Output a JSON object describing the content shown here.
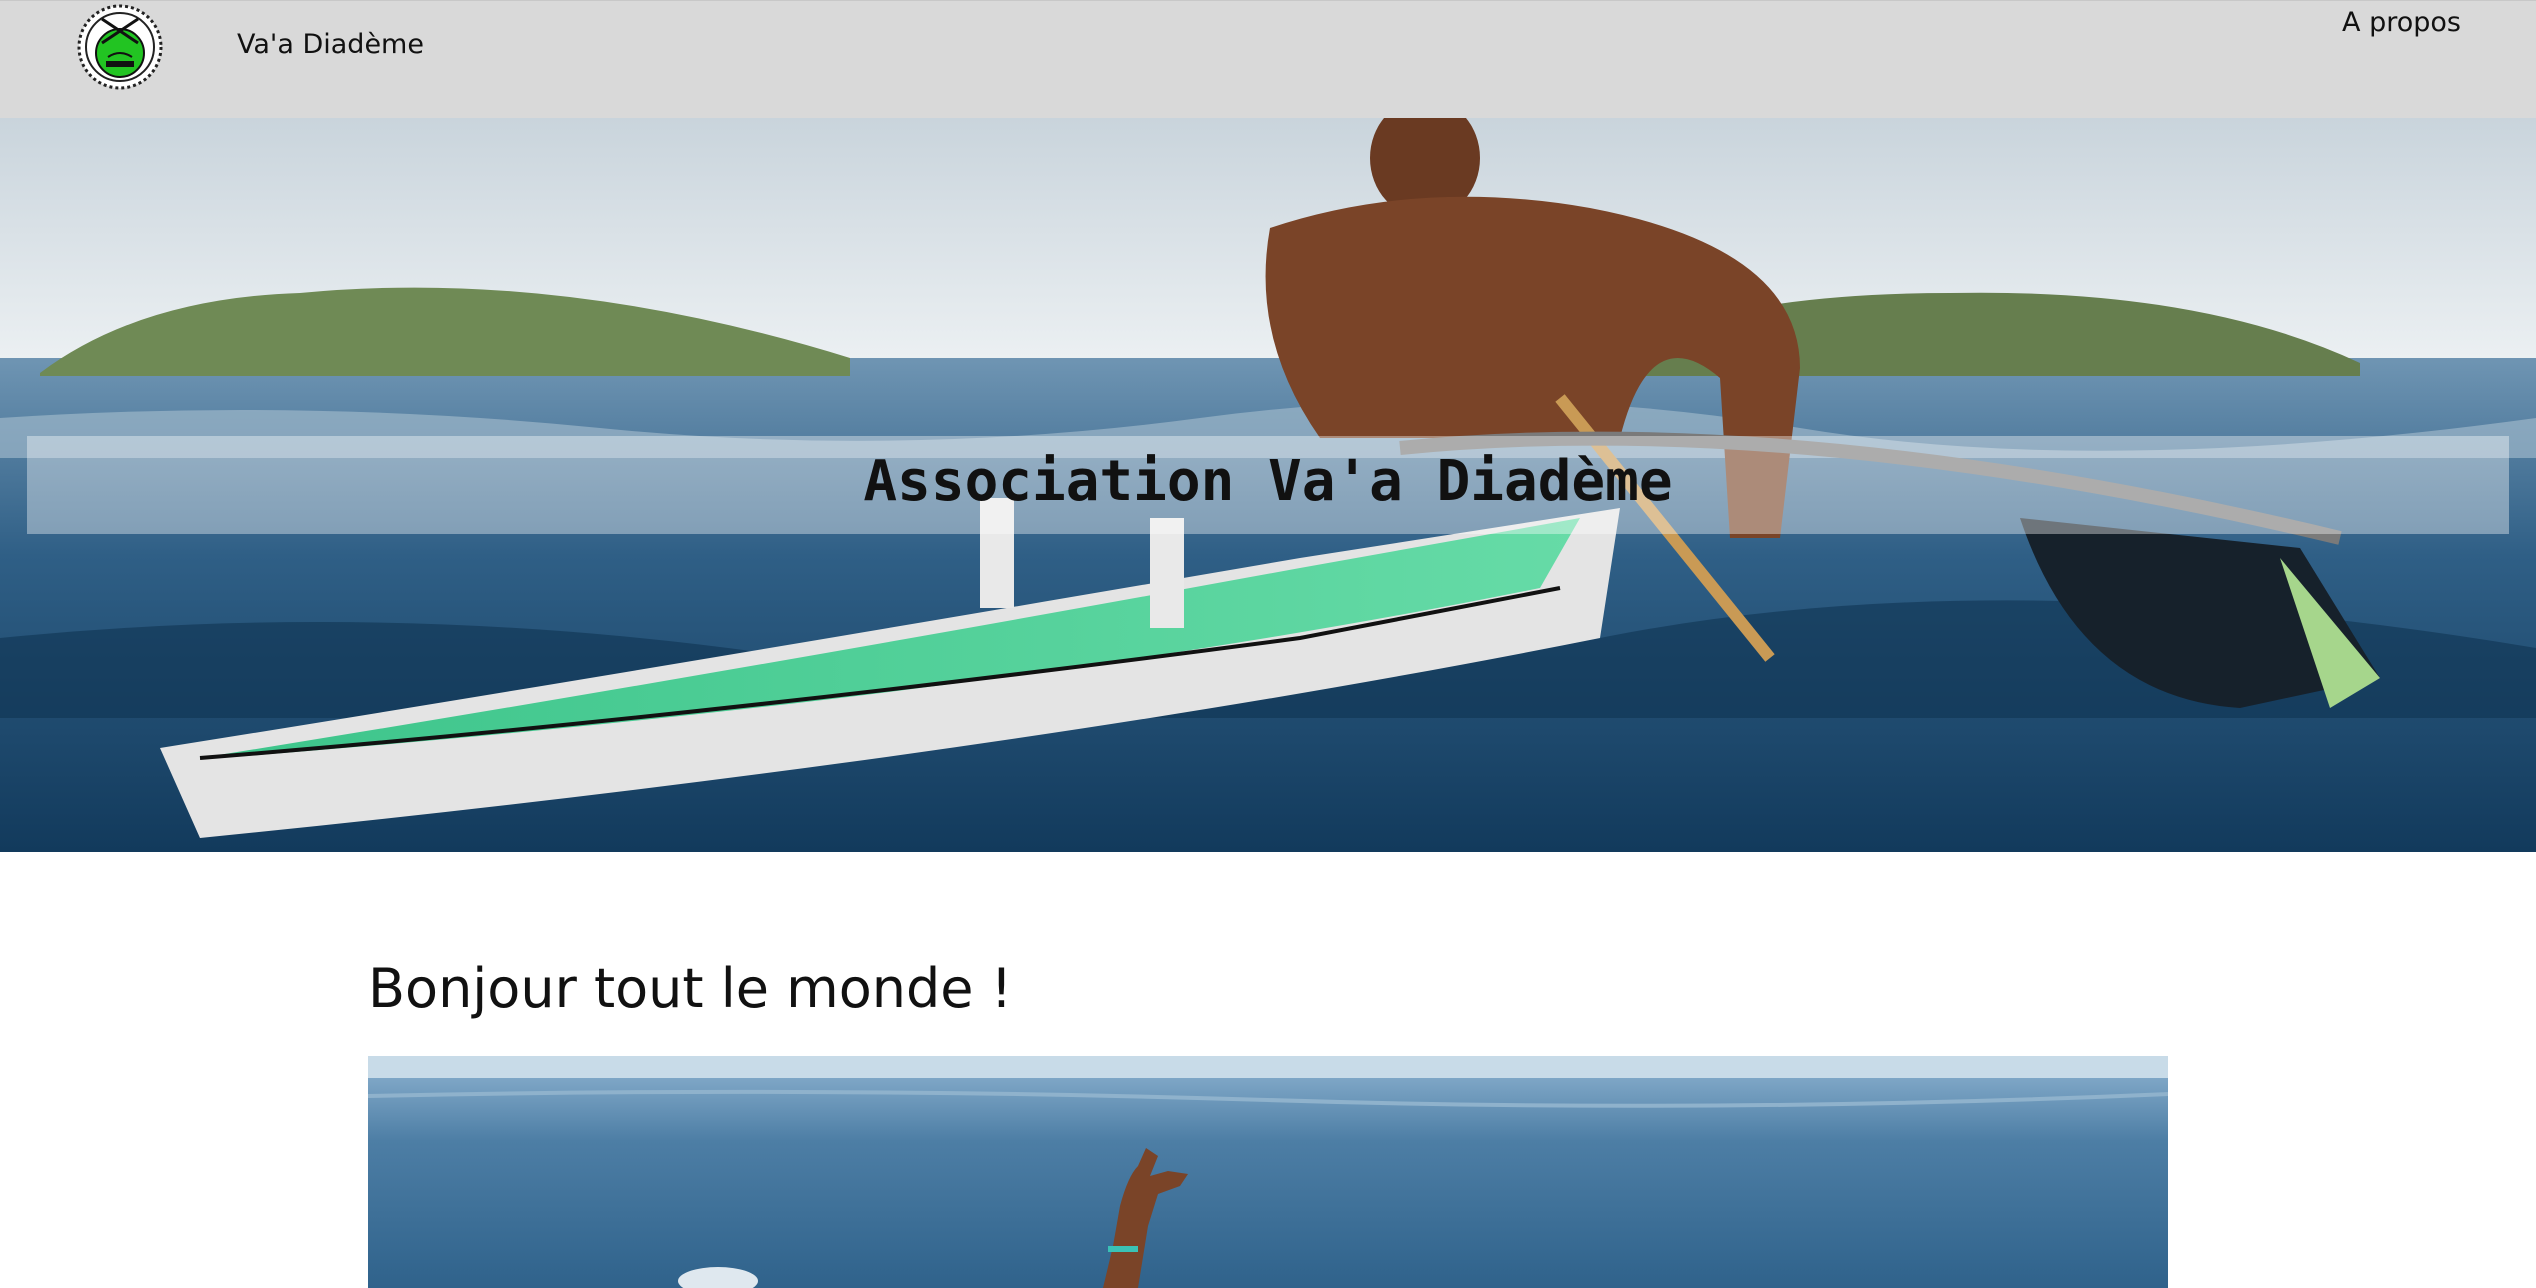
{
  "header": {
    "site_title": "Va'a Diadème",
    "nav_link": "A propos",
    "logo_icon": "club-logo-icon"
  },
  "hero": {
    "title": "Association Va'a Diadème",
    "image_icon": "outrigger-canoe-photo"
  },
  "post": {
    "title": "Bonjour tout le monde !",
    "image_icon": "paddler-ocean-photo"
  },
  "colors": {
    "navbar_bg": "#d9d9d9",
    "text": "#111111",
    "page_bg": "#ffffff"
  }
}
